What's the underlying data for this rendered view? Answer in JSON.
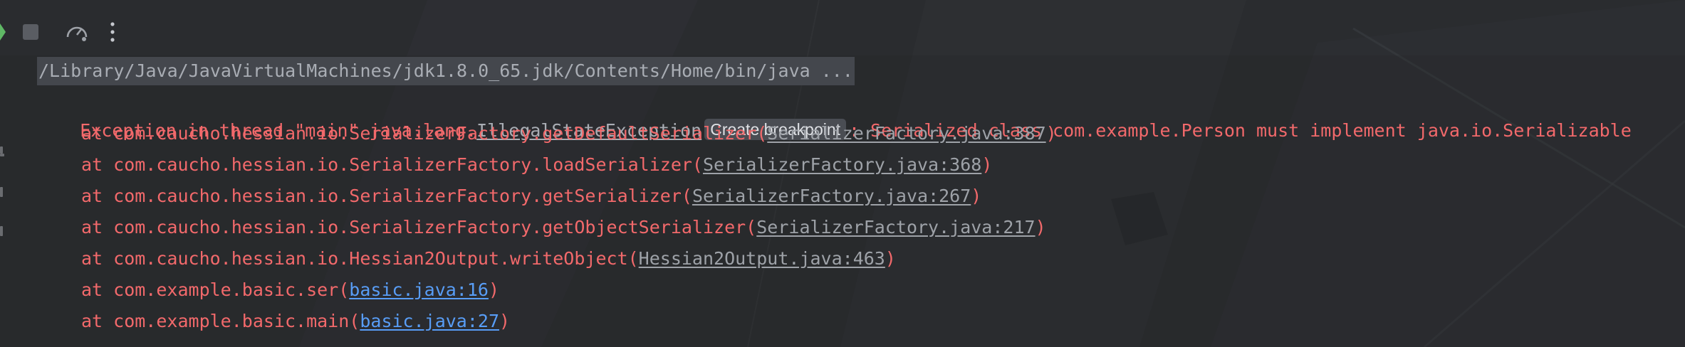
{
  "toolbar": {
    "icons": [
      "rerun-icon",
      "stop-icon",
      "profiler-icon",
      "more-options-icon"
    ]
  },
  "console": {
    "command": "/Library/Java/JavaVirtualMachines/jdk1.8.0_65.jdk/Contents/Home/bin/java ...",
    "exception": {
      "prefix": "Exception in thread \"main\" java.lang.",
      "class_name": "IllegalStateException",
      "breakpoint_label": "Create breakpoint",
      "message": ": Serialized class com.example.Person must implement java.io.Serializable"
    },
    "stack_frames": [
      {
        "text": "at com.caucho.hessian.io.SerializerFactory.getDefaultSerializer(",
        "link": "SerializerFactory.java:387",
        "close": ")",
        "user_code": false
      },
      {
        "text": "at com.caucho.hessian.io.SerializerFactory.loadSerializer(",
        "link": "SerializerFactory.java:368",
        "close": ")",
        "user_code": false
      },
      {
        "text": "at com.caucho.hessian.io.SerializerFactory.getSerializer(",
        "link": "SerializerFactory.java:267",
        "close": ")",
        "user_code": false
      },
      {
        "text": "at com.caucho.hessian.io.SerializerFactory.getObjectSerializer(",
        "link": "SerializerFactory.java:217",
        "close": ")",
        "user_code": false
      },
      {
        "text": "at com.caucho.hessian.io.Hessian2Output.writeObject(",
        "link": "Hessian2Output.java:463",
        "close": ")",
        "user_code": false
      },
      {
        "text": "at com.example.basic.ser(",
        "link": "basic.java:16",
        "close": ")",
        "user_code": true
      },
      {
        "text": "at com.example.basic.main(",
        "link": "basic.java:27",
        "close": ")",
        "user_code": true
      }
    ]
  },
  "colors": {
    "background": "#2b2d30",
    "error_text": "#f2696b",
    "library_link": "#9ea2a8",
    "user_link": "#589df6",
    "command_highlight": "#44474d"
  }
}
